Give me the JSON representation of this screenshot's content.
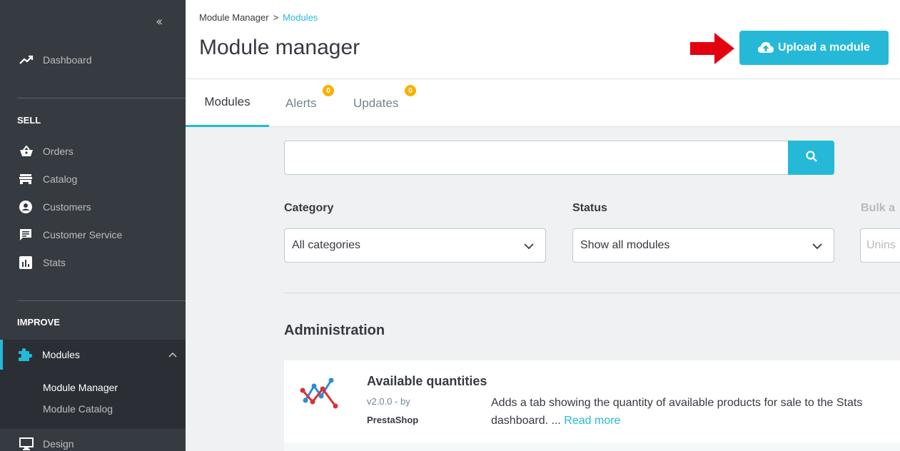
{
  "sidebar": {
    "dashboard": "Dashboard",
    "sell_title": "SELL",
    "sell_items": [
      "Orders",
      "Catalog",
      "Customers",
      "Customer Service",
      "Stats"
    ],
    "improve_title": "IMPROVE",
    "modules": "Modules",
    "submenu": [
      "Module Manager",
      "Module Catalog"
    ],
    "design": "Design"
  },
  "header": {
    "breadcrumb_parent": "Module Manager",
    "breadcrumb_sep": ">",
    "breadcrumb_current": "Modules",
    "title": "Module manager",
    "upload_label": "Upload a module"
  },
  "tabs": [
    {
      "label": "Modules"
    },
    {
      "label": "Alerts",
      "badge": "0"
    },
    {
      "label": "Updates",
      "badge": "0"
    }
  ],
  "search": {
    "value": ""
  },
  "filters": {
    "category_label": "Category",
    "category_value": "All categories",
    "status_label": "Status",
    "status_value": "Show all modules",
    "bulk_label": "Bulk a",
    "bulk_value": "Unins"
  },
  "section": {
    "title": "Administration"
  },
  "module": {
    "name": "Available quantities",
    "version": "v2.0.0 - by",
    "author": "PrestaShop",
    "description": "Adds a tab showing the quantity of available products for sale to the Stats dashboard. ...",
    "read_more": "Read more"
  },
  "colors": {
    "accent": "#25b9d7",
    "sidebar": "#363a41",
    "badge": "#fab000",
    "arrow": "#e3000f"
  }
}
